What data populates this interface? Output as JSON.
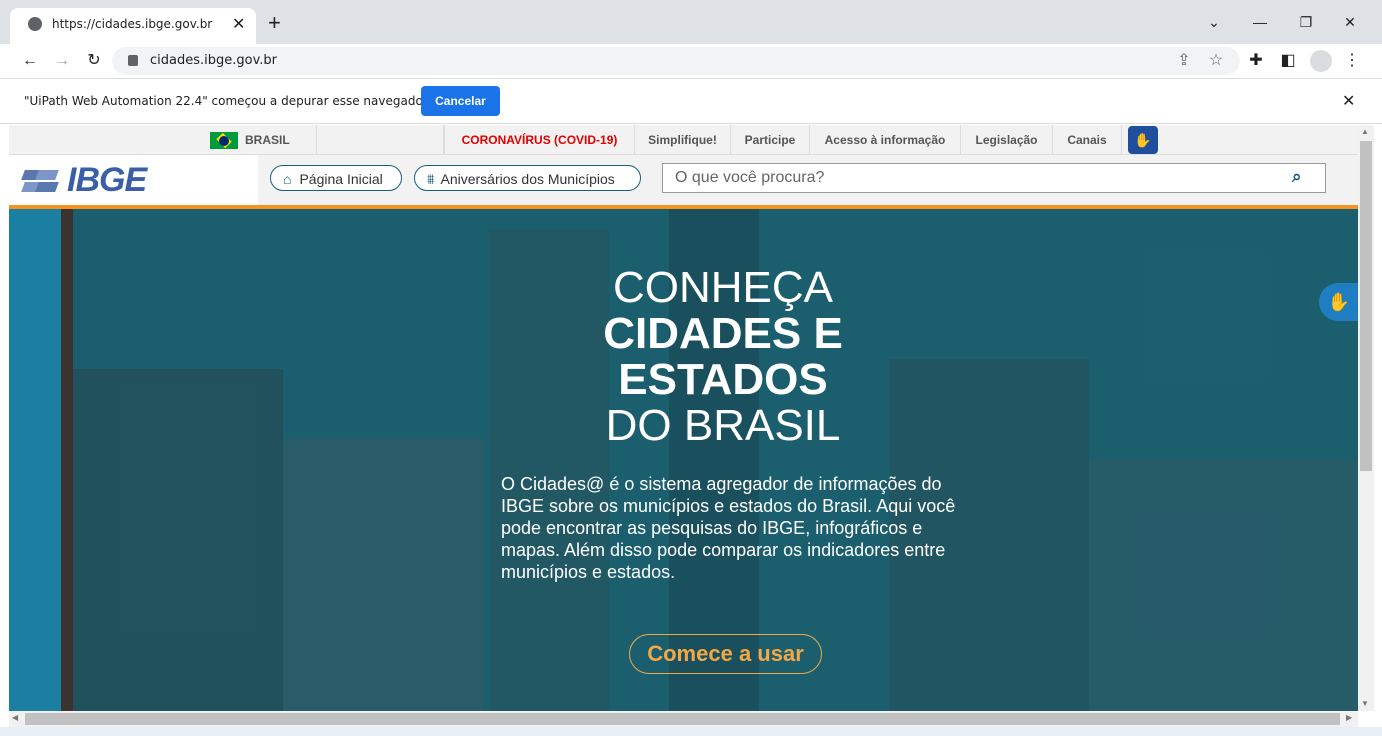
{
  "browser": {
    "tab_title": "https://cidades.ibge.gov.br",
    "url": "cidades.ibge.gov.br",
    "infobar_text": "\"UiPath Web Automation 22.4\" começou a depurar esse navegador",
    "cancel_label": "Cancelar"
  },
  "topnav": {
    "brasil": "BRASIL",
    "covid": "CORONAVÍRUS (COVID-19)",
    "items": [
      "Simplifique!",
      "Participe",
      "Acesso à informação",
      "Legislação",
      "Canais"
    ]
  },
  "header": {
    "logo": "IBGE",
    "home_label": "Página Inicial",
    "anniversary_label": "Aniversários dos Municípios",
    "search_placeholder": "O que você procura?"
  },
  "hero": {
    "line1": "CONHEÇA",
    "line2": "CIDADES E",
    "line3": "ESTADOS",
    "line4": "DO BRASIL",
    "description": "O Cidades@ é o sistema agregador de informações do IBGE sobre os municípios e estados do Brasil. Aqui você pode encontrar as pesquisas do IBGE, infográficos e mapas. Além disso pode comparar os indicadores entre municípios e estados.",
    "cta": "Comece a usar"
  },
  "colors": {
    "accent": "#f7941d",
    "cta": "#f3a847",
    "hero_bg": "#1c5f70",
    "covid": "#e00000",
    "chrome_blue": "#1a73e8"
  }
}
